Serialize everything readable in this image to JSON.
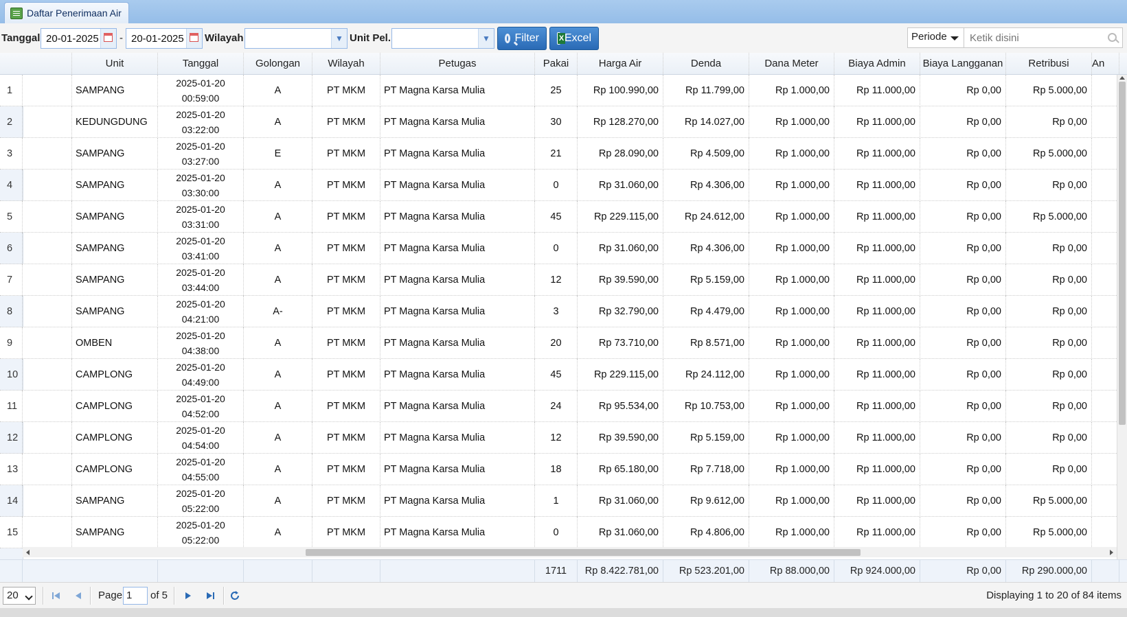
{
  "tab": {
    "title": "Daftar Penerimaan Air"
  },
  "toolbar": {
    "tanggal_label": "Tanggal",
    "date_from": "20-01-2025",
    "date_sep": "-",
    "date_to": "20-01-2025",
    "wilayah_label": "Wilayah",
    "wilayah_value": "",
    "unitpel_label": "Unit Pel.",
    "unitpel_value": "",
    "filter_label": "Filter",
    "excel_label": "Excel",
    "periode_label": "Periode",
    "search_placeholder": "Ketik disini"
  },
  "columns": [
    "Unit",
    "Tanggal",
    "Golongan",
    "Wilayah",
    "Petugas",
    "Pakai",
    "Harga Air",
    "Denda",
    "Dana Meter",
    "Biaya Admin",
    "Biaya Langganan",
    "Retribusi",
    "An"
  ],
  "rows": [
    {
      "no": "1",
      "unit": "SAMPANG",
      "date": "2025-01-20",
      "time": "00:59:00",
      "gol": "A",
      "wil": "PT MKM",
      "petugas": "PT Magna Karsa Mulia",
      "pakai": "25",
      "harga": "Rp 100.990,00",
      "denda": "Rp 11.799,00",
      "dana": "Rp 1.000,00",
      "admin": "Rp 11.000,00",
      "langganan": "Rp 0,00",
      "retribusi": "Rp 5.000,00"
    },
    {
      "no": "2",
      "unit": "KEDUNGDUNG",
      "date": "2025-01-20",
      "time": "03:22:00",
      "gol": "A",
      "wil": "PT MKM",
      "petugas": "PT Magna Karsa Mulia",
      "pakai": "30",
      "harga": "Rp 128.270,00",
      "denda": "Rp 14.027,00",
      "dana": "Rp 1.000,00",
      "admin": "Rp 11.000,00",
      "langganan": "Rp 0,00",
      "retribusi": "Rp 0,00"
    },
    {
      "no": "3",
      "unit": "SAMPANG",
      "date": "2025-01-20",
      "time": "03:27:00",
      "gol": "E",
      "wil": "PT MKM",
      "petugas": "PT Magna Karsa Mulia",
      "pakai": "21",
      "harga": "Rp 28.090,00",
      "denda": "Rp 4.509,00",
      "dana": "Rp 1.000,00",
      "admin": "Rp 11.000,00",
      "langganan": "Rp 0,00",
      "retribusi": "Rp 5.000,00"
    },
    {
      "no": "4",
      "unit": "SAMPANG",
      "date": "2025-01-20",
      "time": "03:30:00",
      "gol": "A",
      "wil": "PT MKM",
      "petugas": "PT Magna Karsa Mulia",
      "pakai": "0",
      "harga": "Rp 31.060,00",
      "denda": "Rp 4.306,00",
      "dana": "Rp 1.000,00",
      "admin": "Rp 11.000,00",
      "langganan": "Rp 0,00",
      "retribusi": "Rp 0,00"
    },
    {
      "no": "5",
      "unit": "SAMPANG",
      "date": "2025-01-20",
      "time": "03:31:00",
      "gol": "A",
      "wil": "PT MKM",
      "petugas": "PT Magna Karsa Mulia",
      "pakai": "45",
      "harga": "Rp 229.115,00",
      "denda": "Rp 24.612,00",
      "dana": "Rp 1.000,00",
      "admin": "Rp 11.000,00",
      "langganan": "Rp 0,00",
      "retribusi": "Rp 5.000,00"
    },
    {
      "no": "6",
      "unit": "SAMPANG",
      "date": "2025-01-20",
      "time": "03:41:00",
      "gol": "A",
      "wil": "PT MKM",
      "petugas": "PT Magna Karsa Mulia",
      "pakai": "0",
      "harga": "Rp 31.060,00",
      "denda": "Rp 4.306,00",
      "dana": "Rp 1.000,00",
      "admin": "Rp 11.000,00",
      "langganan": "Rp 0,00",
      "retribusi": "Rp 0,00"
    },
    {
      "no": "7",
      "unit": "SAMPANG",
      "date": "2025-01-20",
      "time": "03:44:00",
      "gol": "A",
      "wil": "PT MKM",
      "petugas": "PT Magna Karsa Mulia",
      "pakai": "12",
      "harga": "Rp 39.590,00",
      "denda": "Rp 5.159,00",
      "dana": "Rp 1.000,00",
      "admin": "Rp 11.000,00",
      "langganan": "Rp 0,00",
      "retribusi": "Rp 0,00"
    },
    {
      "no": "8",
      "unit": "SAMPANG",
      "date": "2025-01-20",
      "time": "04:21:00",
      "gol": "A-",
      "wil": "PT MKM",
      "petugas": "PT Magna Karsa Mulia",
      "pakai": "3",
      "harga": "Rp 32.790,00",
      "denda": "Rp 4.479,00",
      "dana": "Rp 1.000,00",
      "admin": "Rp 11.000,00",
      "langganan": "Rp 0,00",
      "retribusi": "Rp 0,00"
    },
    {
      "no": "9",
      "unit": "OMBEN",
      "date": "2025-01-20",
      "time": "04:38:00",
      "gol": "A",
      "wil": "PT MKM",
      "petugas": "PT Magna Karsa Mulia",
      "pakai": "20",
      "harga": "Rp 73.710,00",
      "denda": "Rp 8.571,00",
      "dana": "Rp 1.000,00",
      "admin": "Rp 11.000,00",
      "langganan": "Rp 0,00",
      "retribusi": "Rp 0,00"
    },
    {
      "no": "10",
      "unit": "CAMPLONG",
      "date": "2025-01-20",
      "time": "04:49:00",
      "gol": "A",
      "wil": "PT MKM",
      "petugas": "PT Magna Karsa Mulia",
      "pakai": "45",
      "harga": "Rp 229.115,00",
      "denda": "Rp 24.112,00",
      "dana": "Rp 1.000,00",
      "admin": "Rp 11.000,00",
      "langganan": "Rp 0,00",
      "retribusi": "Rp 0,00"
    },
    {
      "no": "11",
      "unit": "CAMPLONG",
      "date": "2025-01-20",
      "time": "04:52:00",
      "gol": "A",
      "wil": "PT MKM",
      "petugas": "PT Magna Karsa Mulia",
      "pakai": "24",
      "harga": "Rp 95.534,00",
      "denda": "Rp 10.753,00",
      "dana": "Rp 1.000,00",
      "admin": "Rp 11.000,00",
      "langganan": "Rp 0,00",
      "retribusi": "Rp 0,00"
    },
    {
      "no": "12",
      "unit": "CAMPLONG",
      "date": "2025-01-20",
      "time": "04:54:00",
      "gol": "A",
      "wil": "PT MKM",
      "petugas": "PT Magna Karsa Mulia",
      "pakai": "12",
      "harga": "Rp 39.590,00",
      "denda": "Rp 5.159,00",
      "dana": "Rp 1.000,00",
      "admin": "Rp 11.000,00",
      "langganan": "Rp 0,00",
      "retribusi": "Rp 0,00"
    },
    {
      "no": "13",
      "unit": "CAMPLONG",
      "date": "2025-01-20",
      "time": "04:55:00",
      "gol": "A",
      "wil": "PT MKM",
      "petugas": "PT Magna Karsa Mulia",
      "pakai": "18",
      "harga": "Rp 65.180,00",
      "denda": "Rp 7.718,00",
      "dana": "Rp 1.000,00",
      "admin": "Rp 11.000,00",
      "langganan": "Rp 0,00",
      "retribusi": "Rp 0,00"
    },
    {
      "no": "14",
      "unit": "SAMPANG",
      "date": "2025-01-20",
      "time": "05:22:00",
      "gol": "A",
      "wil": "PT MKM",
      "petugas": "PT Magna Karsa Mulia",
      "pakai": "1",
      "harga": "Rp 31.060,00",
      "denda": "Rp 9.612,00",
      "dana": "Rp 1.000,00",
      "admin": "Rp 11.000,00",
      "langganan": "Rp 0,00",
      "retribusi": "Rp 5.000,00"
    },
    {
      "no": "15",
      "unit": "SAMPANG",
      "date": "2025-01-20",
      "time": "05:22:00",
      "gol": "A",
      "wil": "PT MKM",
      "petugas": "PT Magna Karsa Mulia",
      "pakai": "0",
      "harga": "Rp 31.060,00",
      "denda": "Rp 4.806,00",
      "dana": "Rp 1.000,00",
      "admin": "Rp 11.000,00",
      "langganan": "Rp 0,00",
      "retribusi": "Rp 5.000,00"
    }
  ],
  "totals": {
    "pakai": "1711",
    "harga": "Rp 8.422.781,00",
    "denda": "Rp 523.201,00",
    "dana": "Rp 88.000,00",
    "admin": "Rp 924.000,00",
    "langganan": "Rp 0,00",
    "retribusi": "Rp 290.000,00"
  },
  "pager": {
    "page_size": "20",
    "page_label": "Page",
    "page_value": "1",
    "of_label": "of 5",
    "info": "Displaying 1 to 20 of 84 items"
  },
  "colors": {
    "accent": "#2a6ab5",
    "header_bg": "#95bde8"
  },
  "icons": {
    "tab": "table-icon",
    "filter": "search-icon",
    "excel": "excel-icon",
    "calendar": "calendar-icon"
  }
}
